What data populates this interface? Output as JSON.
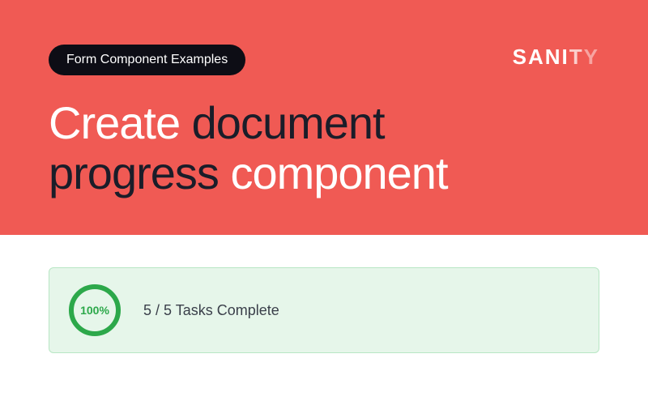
{
  "hero": {
    "badge": "Form Component Examples",
    "brand_main": "SANI",
    "brand_fade1": "T",
    "brand_fade2": "Y",
    "title_word1": "Create",
    "title_word2": "document",
    "title_word3": "progress",
    "title_word4": "component"
  },
  "progress": {
    "percent": "100%",
    "label": "5 / 5 Tasks Complete"
  },
  "colors": {
    "hero_bg": "#f05a54",
    "badge_bg": "#0d0d15",
    "card_bg": "#e6f6ea",
    "card_border": "#b8e6c4",
    "ring": "#2ca84a"
  }
}
